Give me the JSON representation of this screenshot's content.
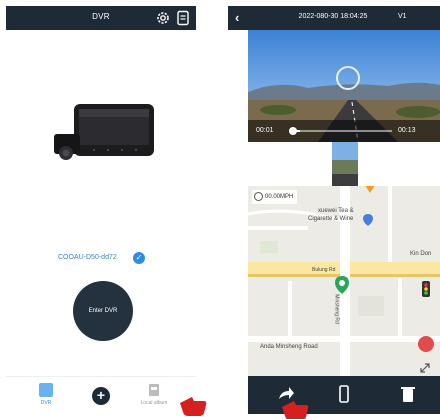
{
  "left_screen": {
    "header": {
      "title": "DVR"
    },
    "device": {
      "name": "COOAU-D50-dd72"
    },
    "enter_button": {
      "label": "Enter DVR"
    },
    "tabbar": {
      "tabs": [
        {
          "label": "DVR",
          "active": true
        },
        {
          "label": "",
          "icon": "plus-icon"
        },
        {
          "label": "Local album"
        }
      ]
    }
  },
  "right_screen": {
    "header": {
      "timestamp": "2022-080-30 18:04:25",
      "tag": "V1"
    },
    "player": {
      "current_time": "00:01",
      "end_time": "00:13",
      "progress": 0.08
    },
    "map": {
      "speed": "00.00MPH",
      "labels": {
        "shop": "xuewei Tea &",
        "shop2": "Cigarette & Wine",
        "kin": "Kin Don",
        "road1": "Bulung Rd",
        "road2": "Minsheng Rd",
        "road3": "Anda Minsheng Road"
      }
    },
    "toolbar": {
      "icons": [
        "share-icon",
        "phone-icon",
        "trash-icon"
      ]
    }
  },
  "colors": {
    "dark_bar": "#1f2a37",
    "accent": "#2e8be6",
    "hand": "#d62020"
  }
}
